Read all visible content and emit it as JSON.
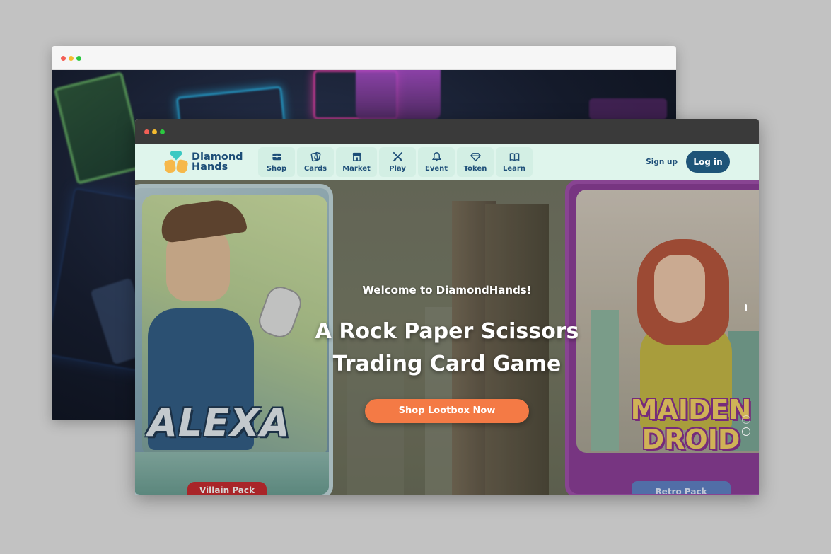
{
  "site": {
    "brand_line1": "Diamond",
    "brand_line2": "Hands",
    "nav": [
      {
        "label": "Shop",
        "icon": "chest-icon"
      },
      {
        "label": "Cards",
        "icon": "cards-icon"
      },
      {
        "label": "Market",
        "icon": "storefront-icon"
      },
      {
        "label": "Play",
        "icon": "crossed-swords-icon"
      },
      {
        "label": "Event",
        "icon": "bell-icon"
      },
      {
        "label": "Token",
        "icon": "diamond-icon"
      },
      {
        "label": "Learn",
        "icon": "book-icon"
      }
    ],
    "signup_label": "Sign up",
    "login_label": "Log in"
  },
  "hero": {
    "welcome": "Welcome to DiamondHands!",
    "headline_line1": "A Rock Paper Scissors",
    "headline_line2": "Trading Card Game",
    "cta_label": "Shop Lootbox Now",
    "left_card": {
      "name": "ALEXA",
      "pack_label": "Villain Pack"
    },
    "right_card": {
      "name_line1": "MAIDEN",
      "name_line2": "DROID",
      "pack_label": "Retro Pack"
    }
  },
  "colors": {
    "nav_bg": "#dff5ec",
    "brand_blue": "#1d4e78",
    "login_bg": "#1e5478",
    "cta_orange": "#f47a45"
  }
}
